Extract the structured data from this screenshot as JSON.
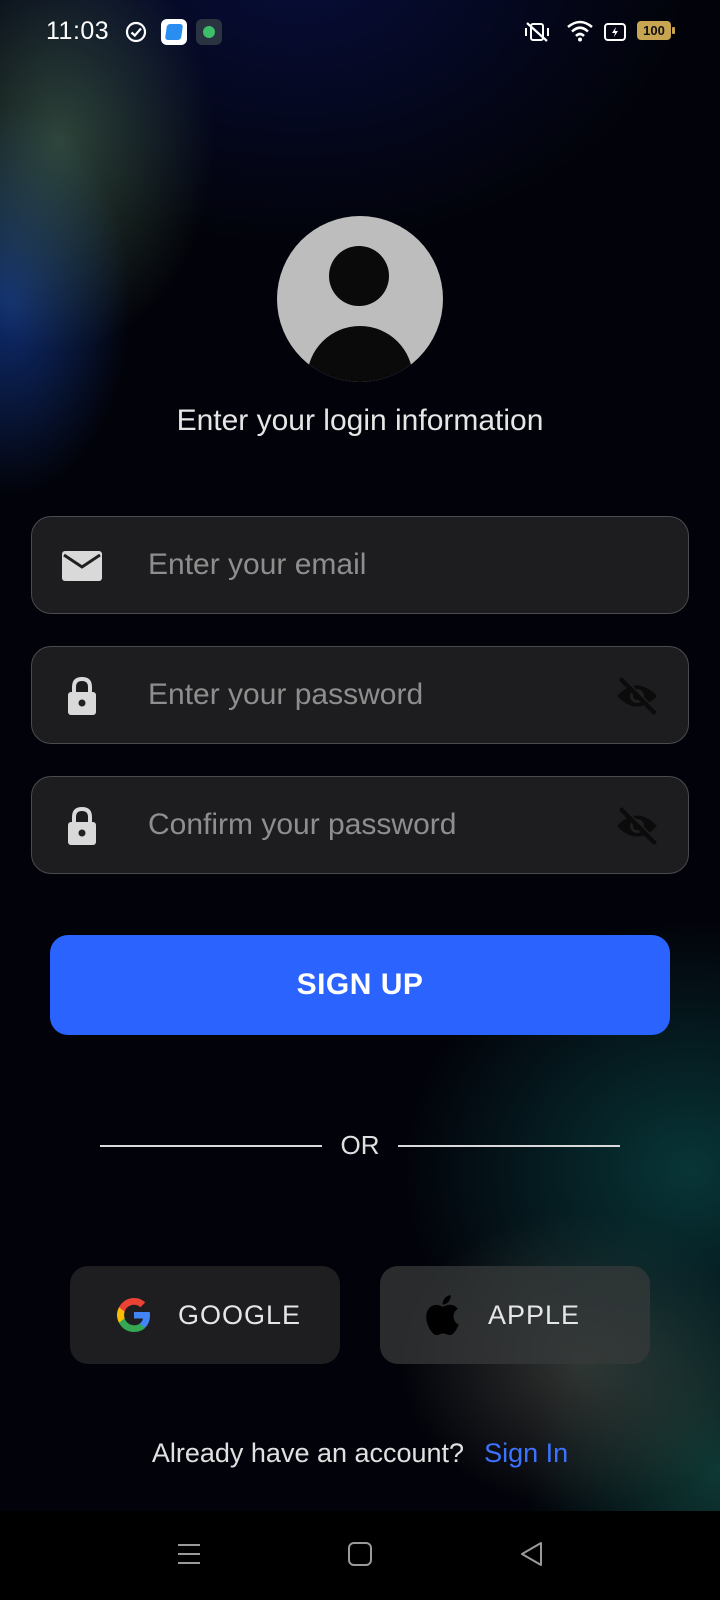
{
  "status_bar": {
    "time": "11:03",
    "battery": "100"
  },
  "colors": {
    "accent": "#2b63ff",
    "link": "#3b73ff",
    "field_background": "#202022",
    "avatar": "#bdbdbd"
  },
  "header": {
    "subtitle": "Enter your login information"
  },
  "form": {
    "email": {
      "placeholder": "Enter your email",
      "value": "",
      "icon": "mail-icon"
    },
    "password": {
      "placeholder": "Enter your password",
      "value": "",
      "icon": "lock-icon",
      "toggle_icon": "eye-off-icon"
    },
    "confirm_password": {
      "placeholder": "Confirm your password",
      "value": "",
      "icon": "lock-icon",
      "toggle_icon": "eye-off-icon"
    },
    "submit_label": "SIGN UP"
  },
  "divider": {
    "label": "OR"
  },
  "social": {
    "google": {
      "label": "GOOGLE",
      "icon": "google-icon"
    },
    "apple": {
      "label": "APPLE",
      "icon": "apple-icon"
    }
  },
  "footer": {
    "prompt": "Already have an account?",
    "link": "Sign In"
  },
  "nav_bar": {
    "icons": [
      "menu-icon",
      "home-icon",
      "back-icon"
    ]
  }
}
